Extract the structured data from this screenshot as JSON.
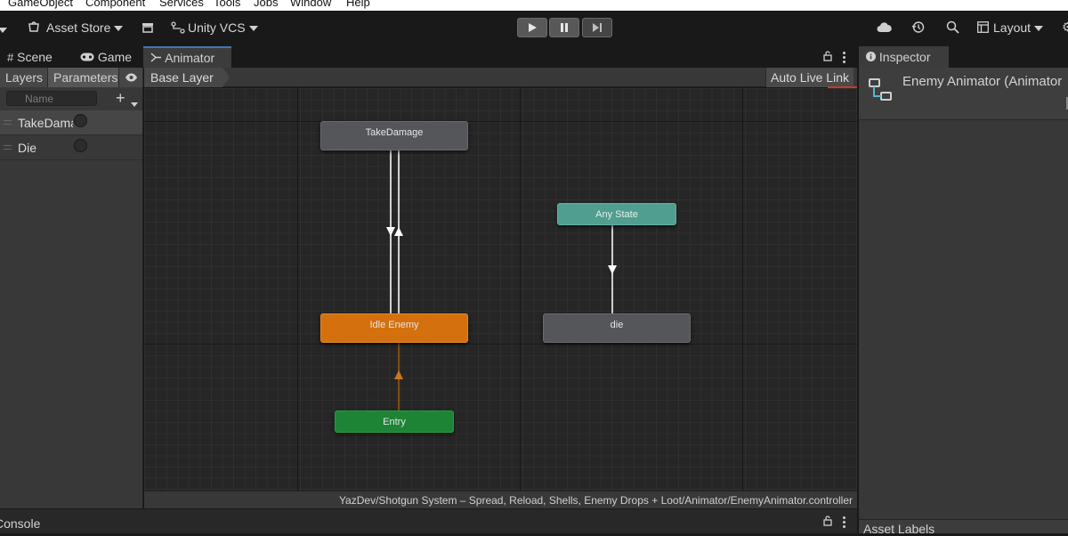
{
  "menu": [
    "GameObject",
    "Component",
    "Services",
    "Tools",
    "Jobs",
    "Window",
    "Help"
  ],
  "toolbar": {
    "asset_store": "Asset Store",
    "vcs": "Unity VCS",
    "layout": "Layout"
  },
  "tabs": {
    "scene": "Scene",
    "game": "Game",
    "animator": "Animator",
    "inspector": "Inspector"
  },
  "animator": {
    "layers_tab": "Layers",
    "parameters_tab": "Parameters",
    "search_placeholder": "Name",
    "parameters": [
      {
        "name": "TakeDamage"
      },
      {
        "name": "Die"
      }
    ],
    "breadcrumb": "Base Layer",
    "auto_live_link": "Auto Live Link",
    "states": {
      "take_damage": "TakeDamage",
      "idle": "Idle Enemy",
      "entry": "Entry",
      "any_state": "Any State",
      "die": "die"
    },
    "controller_path": "YazDev/Shotgun System – Spread, Reload, Shells, Enemy Drops + Loot/Animator/EnemyAnimator.controller"
  },
  "inspector": {
    "title": "Enemy Animator (Animator",
    "asset_labels": "Asset Labels"
  },
  "console": {
    "label": "Console"
  },
  "colors": {
    "idle_state": "#d4700d",
    "entry_state": "#1d8436",
    "any_state": "#4f9e90",
    "normal_state": "#555659",
    "live_link_indicator": "#c23b2b"
  }
}
